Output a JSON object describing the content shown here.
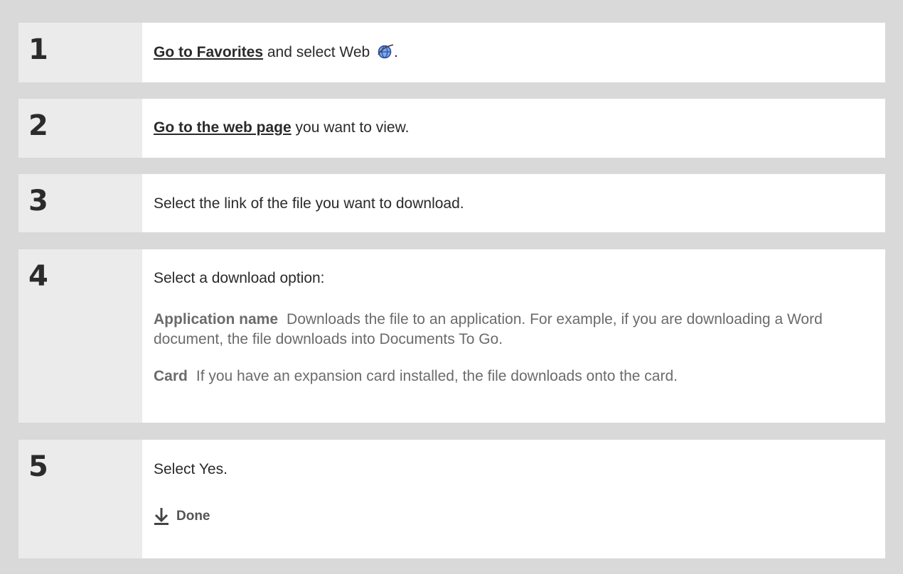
{
  "steps": [
    {
      "number": "1",
      "link_text": "Go to Favorites",
      "text_after": " and select Web",
      "icon": "web-globe-icon",
      "text_end": "."
    },
    {
      "number": "2",
      "link_text": "Go to the web page",
      "text_after": " you want to view."
    },
    {
      "number": "3",
      "text": "Select the link of the file you want to download."
    },
    {
      "number": "4",
      "text": "Select a download option:",
      "options": [
        {
          "term": "Application name",
          "description": "Downloads the file to an application. For example, if you are downloading a Word document, the file downloads into Documents To Go."
        },
        {
          "term": "Card",
          "description": "If you have an expansion card installed, the file downloads onto the card."
        }
      ]
    },
    {
      "number": "5",
      "text": "Select Yes.",
      "done_label": "Done",
      "done_icon": "down-arrow-icon"
    }
  ],
  "colors": {
    "background": "#d9d9d9",
    "number_column": "#ebebeb",
    "content": "#ffffff",
    "muted_text": "#6b6b6b"
  }
}
